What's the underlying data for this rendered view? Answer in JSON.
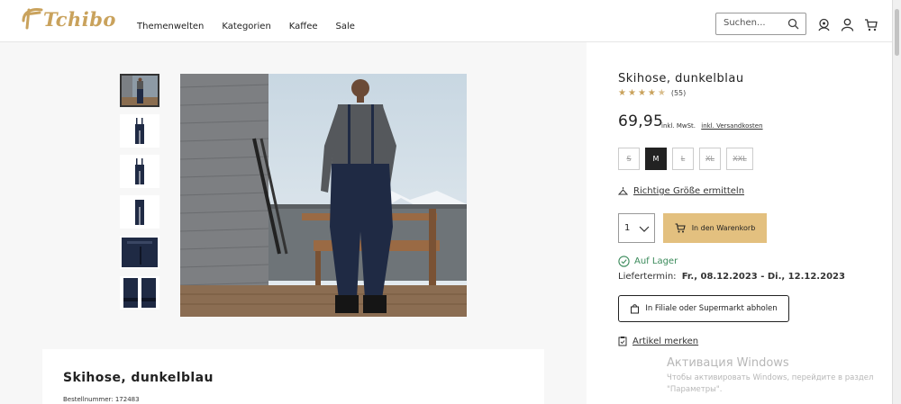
{
  "header": {
    "logo_text": "Tchibo",
    "nav": [
      "Themenwelten",
      "Kategorien",
      "Kaffee",
      "Sale"
    ],
    "search_placeholder": "Suchen...",
    "icons": [
      "search-icon",
      "location-icon",
      "user-icon",
      "cart-icon"
    ],
    "brand_color": "#c9a25c"
  },
  "product": {
    "title": "Skihose, dunkelblau",
    "rating_count": "(55)",
    "rating_value": 4.5,
    "price": "69,95",
    "vat_note": "inkl. MwSt.",
    "shipping_note": "inkl. Versandkosten",
    "sizes": [
      {
        "label": "S",
        "available": false
      },
      {
        "label": "M",
        "available": true,
        "selected": true
      },
      {
        "label": "L",
        "available": false
      },
      {
        "label": "XL",
        "available": false
      },
      {
        "label": "XXL",
        "available": false
      }
    ],
    "size_help": "Richtige Größe ermitteln",
    "quantity": "1",
    "add_to_cart": "In den Warenkorb",
    "stock_status": "Auf Lager",
    "delivery_label": "Liefertermin:",
    "delivery_dates": "Fr., 08.12.2023 - Di., 12.12.2023",
    "store_pickup": "In Filiale oder Supermarkt abholen",
    "wishlist": "Artikel merken",
    "cart_button_color": "#e3c07f",
    "stock_color": "#3a8a5a"
  },
  "details": {
    "title": "Skihose, dunkelblau",
    "order_number": "Bestellnummer: 172483"
  },
  "watermark": {
    "title": "Активация Windows",
    "text": "Чтобы активировать Windows, перейдите в раздел \"Параметры\"."
  }
}
